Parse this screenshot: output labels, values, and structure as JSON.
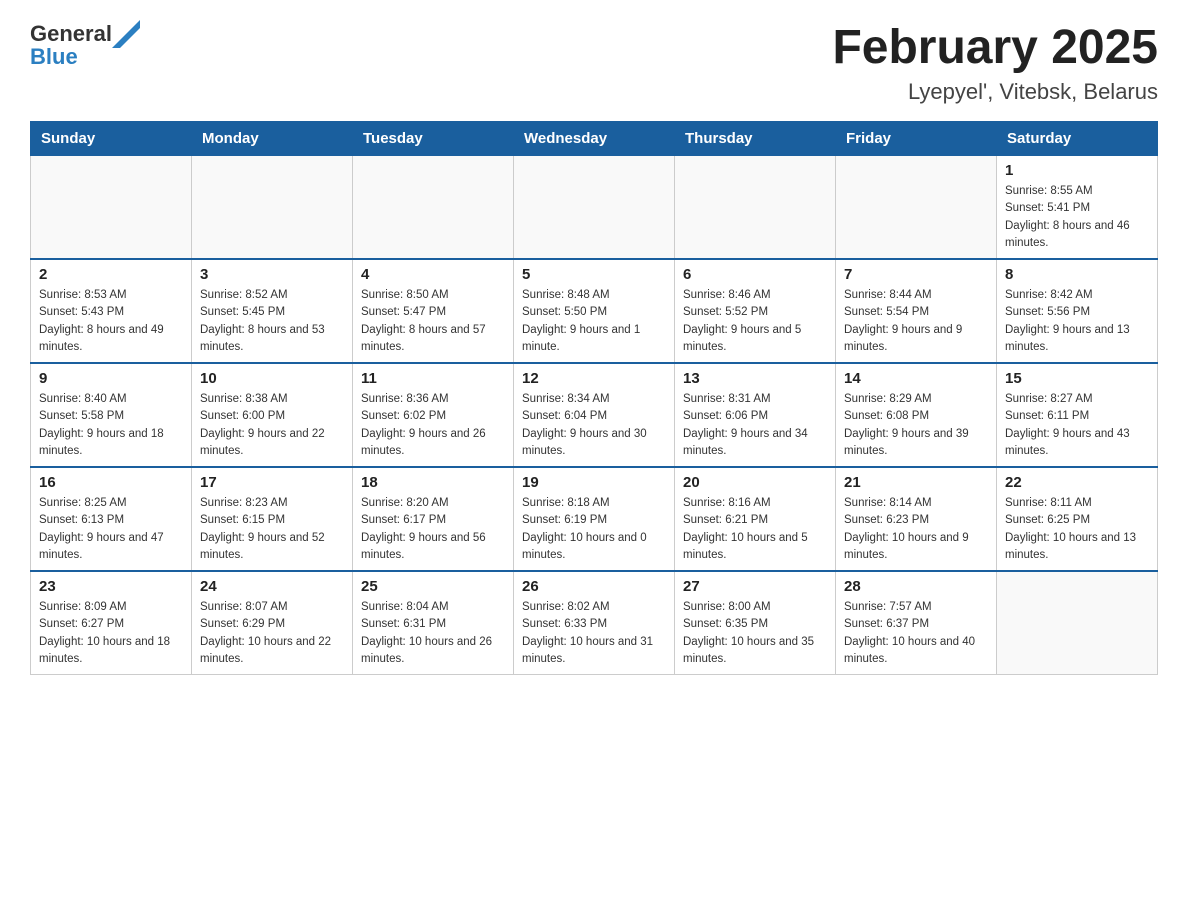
{
  "header": {
    "logo_general": "General",
    "logo_blue": "Blue",
    "title": "February 2025",
    "subtitle": "Lyepyel', Vitebsk, Belarus"
  },
  "weekdays": [
    "Sunday",
    "Monday",
    "Tuesday",
    "Wednesday",
    "Thursday",
    "Friday",
    "Saturday"
  ],
  "weeks": [
    [
      {
        "day": "",
        "sunrise": "",
        "sunset": "",
        "daylight": ""
      },
      {
        "day": "",
        "sunrise": "",
        "sunset": "",
        "daylight": ""
      },
      {
        "day": "",
        "sunrise": "",
        "sunset": "",
        "daylight": ""
      },
      {
        "day": "",
        "sunrise": "",
        "sunset": "",
        "daylight": ""
      },
      {
        "day": "",
        "sunrise": "",
        "sunset": "",
        "daylight": ""
      },
      {
        "day": "",
        "sunrise": "",
        "sunset": "",
        "daylight": ""
      },
      {
        "day": "1",
        "sunrise": "Sunrise: 8:55 AM",
        "sunset": "Sunset: 5:41 PM",
        "daylight": "Daylight: 8 hours and 46 minutes."
      }
    ],
    [
      {
        "day": "2",
        "sunrise": "Sunrise: 8:53 AM",
        "sunset": "Sunset: 5:43 PM",
        "daylight": "Daylight: 8 hours and 49 minutes."
      },
      {
        "day": "3",
        "sunrise": "Sunrise: 8:52 AM",
        "sunset": "Sunset: 5:45 PM",
        "daylight": "Daylight: 8 hours and 53 minutes."
      },
      {
        "day": "4",
        "sunrise": "Sunrise: 8:50 AM",
        "sunset": "Sunset: 5:47 PM",
        "daylight": "Daylight: 8 hours and 57 minutes."
      },
      {
        "day": "5",
        "sunrise": "Sunrise: 8:48 AM",
        "sunset": "Sunset: 5:50 PM",
        "daylight": "Daylight: 9 hours and 1 minute."
      },
      {
        "day": "6",
        "sunrise": "Sunrise: 8:46 AM",
        "sunset": "Sunset: 5:52 PM",
        "daylight": "Daylight: 9 hours and 5 minutes."
      },
      {
        "day": "7",
        "sunrise": "Sunrise: 8:44 AM",
        "sunset": "Sunset: 5:54 PM",
        "daylight": "Daylight: 9 hours and 9 minutes."
      },
      {
        "day": "8",
        "sunrise": "Sunrise: 8:42 AM",
        "sunset": "Sunset: 5:56 PM",
        "daylight": "Daylight: 9 hours and 13 minutes."
      }
    ],
    [
      {
        "day": "9",
        "sunrise": "Sunrise: 8:40 AM",
        "sunset": "Sunset: 5:58 PM",
        "daylight": "Daylight: 9 hours and 18 minutes."
      },
      {
        "day": "10",
        "sunrise": "Sunrise: 8:38 AM",
        "sunset": "Sunset: 6:00 PM",
        "daylight": "Daylight: 9 hours and 22 minutes."
      },
      {
        "day": "11",
        "sunrise": "Sunrise: 8:36 AM",
        "sunset": "Sunset: 6:02 PM",
        "daylight": "Daylight: 9 hours and 26 minutes."
      },
      {
        "day": "12",
        "sunrise": "Sunrise: 8:34 AM",
        "sunset": "Sunset: 6:04 PM",
        "daylight": "Daylight: 9 hours and 30 minutes."
      },
      {
        "day": "13",
        "sunrise": "Sunrise: 8:31 AM",
        "sunset": "Sunset: 6:06 PM",
        "daylight": "Daylight: 9 hours and 34 minutes."
      },
      {
        "day": "14",
        "sunrise": "Sunrise: 8:29 AM",
        "sunset": "Sunset: 6:08 PM",
        "daylight": "Daylight: 9 hours and 39 minutes."
      },
      {
        "day": "15",
        "sunrise": "Sunrise: 8:27 AM",
        "sunset": "Sunset: 6:11 PM",
        "daylight": "Daylight: 9 hours and 43 minutes."
      }
    ],
    [
      {
        "day": "16",
        "sunrise": "Sunrise: 8:25 AM",
        "sunset": "Sunset: 6:13 PM",
        "daylight": "Daylight: 9 hours and 47 minutes."
      },
      {
        "day": "17",
        "sunrise": "Sunrise: 8:23 AM",
        "sunset": "Sunset: 6:15 PM",
        "daylight": "Daylight: 9 hours and 52 minutes."
      },
      {
        "day": "18",
        "sunrise": "Sunrise: 8:20 AM",
        "sunset": "Sunset: 6:17 PM",
        "daylight": "Daylight: 9 hours and 56 minutes."
      },
      {
        "day": "19",
        "sunrise": "Sunrise: 8:18 AM",
        "sunset": "Sunset: 6:19 PM",
        "daylight": "Daylight: 10 hours and 0 minutes."
      },
      {
        "day": "20",
        "sunrise": "Sunrise: 8:16 AM",
        "sunset": "Sunset: 6:21 PM",
        "daylight": "Daylight: 10 hours and 5 minutes."
      },
      {
        "day": "21",
        "sunrise": "Sunrise: 8:14 AM",
        "sunset": "Sunset: 6:23 PM",
        "daylight": "Daylight: 10 hours and 9 minutes."
      },
      {
        "day": "22",
        "sunrise": "Sunrise: 8:11 AM",
        "sunset": "Sunset: 6:25 PM",
        "daylight": "Daylight: 10 hours and 13 minutes."
      }
    ],
    [
      {
        "day": "23",
        "sunrise": "Sunrise: 8:09 AM",
        "sunset": "Sunset: 6:27 PM",
        "daylight": "Daylight: 10 hours and 18 minutes."
      },
      {
        "day": "24",
        "sunrise": "Sunrise: 8:07 AM",
        "sunset": "Sunset: 6:29 PM",
        "daylight": "Daylight: 10 hours and 22 minutes."
      },
      {
        "day": "25",
        "sunrise": "Sunrise: 8:04 AM",
        "sunset": "Sunset: 6:31 PM",
        "daylight": "Daylight: 10 hours and 26 minutes."
      },
      {
        "day": "26",
        "sunrise": "Sunrise: 8:02 AM",
        "sunset": "Sunset: 6:33 PM",
        "daylight": "Daylight: 10 hours and 31 minutes."
      },
      {
        "day": "27",
        "sunrise": "Sunrise: 8:00 AM",
        "sunset": "Sunset: 6:35 PM",
        "daylight": "Daylight: 10 hours and 35 minutes."
      },
      {
        "day": "28",
        "sunrise": "Sunrise: 7:57 AM",
        "sunset": "Sunset: 6:37 PM",
        "daylight": "Daylight: 10 hours and 40 minutes."
      },
      {
        "day": "",
        "sunrise": "",
        "sunset": "",
        "daylight": ""
      }
    ]
  ]
}
